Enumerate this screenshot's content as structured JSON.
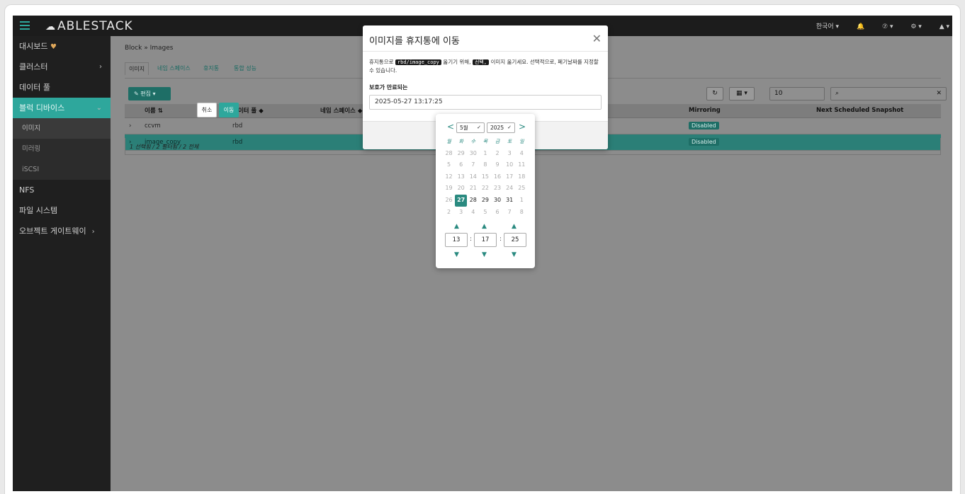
{
  "topbar": {
    "logo": "ABLESTACK",
    "lang": "한국어 ▾",
    "help": "⑦ ▾",
    "gear": "⚙ ▾",
    "user": "▲ ▾"
  },
  "sidebar": {
    "items": [
      {
        "label": "대시보드",
        "badge": "♥"
      },
      {
        "label": "클러스터",
        "arrow": "›"
      },
      {
        "label": "데이터 풀"
      },
      {
        "label": "블럭 디바이스",
        "arrow": "⌄"
      },
      {
        "label": "이미지"
      },
      {
        "label": "미러링"
      },
      {
        "label": "iSCSI"
      },
      {
        "label": "NFS"
      },
      {
        "label": "파일 시스템"
      },
      {
        "label": "오브젝트 게이트웨이",
        "arrow": "›"
      }
    ]
  },
  "content": {
    "breadcrumb": "Block  »  Images",
    "tabs": [
      "이미지",
      "네임 스페이스",
      "휴지통",
      "통합 성능"
    ],
    "edit_label": "✎ 편집  ▾",
    "refresh": "↻",
    "columns_btn": "▦ ▾",
    "per_page": "10",
    "search_icon": "🔍",
    "clear": "✕",
    "table": {
      "headers": [
        "",
        "이름  ⇅",
        "데이터 풀  ◆",
        "네임 스페이스  ◆",
        "",
        "Mirroring",
        "Next Scheduled Snapshot"
      ],
      "rows": [
        {
          "expand": "›",
          "name": "ccvm",
          "pool": "rbd",
          "mirroring": "Disabled"
        },
        {
          "expand": "›",
          "name": "image_copy",
          "pool": "rbd",
          "mirroring": "Disabled"
        }
      ]
    },
    "footer": "1 선택됨 / 2 필터됨 / 2 전체"
  },
  "modal": {
    "title": "이미지를 휴지통에 이동",
    "close": "✕",
    "body_pre": "휴지통으로 ",
    "code1": "rbd/image_copy",
    "body_mid": " 옮기기 위해, ",
    "code2": "선택,",
    "body_post": " 이미지 옮기세요. 선택적으로, 폐기날짜를 지정할 수 있습니다.",
    "field_label": "보호가 만료되는",
    "date_value": "2025-05-27 13:17:25",
    "cancel": "취소",
    "ok": "이동"
  },
  "picker": {
    "month": "5월",
    "year": "2025",
    "weekdays": [
      "월",
      "화",
      "수",
      "목",
      "금",
      "토",
      "일"
    ],
    "weeks": [
      [
        "28",
        "29",
        "30",
        "1",
        "2",
        "3",
        "4"
      ],
      [
        "5",
        "6",
        "7",
        "8",
        "9",
        "10",
        "11"
      ],
      [
        "12",
        "13",
        "14",
        "15",
        "16",
        "17",
        "18"
      ],
      [
        "19",
        "20",
        "21",
        "22",
        "23",
        "24",
        "25"
      ],
      [
        "26",
        "27",
        "28",
        "29",
        "30",
        "31",
        "1"
      ],
      [
        "2",
        "3",
        "4",
        "5",
        "6",
        "7",
        "8"
      ]
    ],
    "hour": "13",
    "minute": "17",
    "second": "25"
  }
}
